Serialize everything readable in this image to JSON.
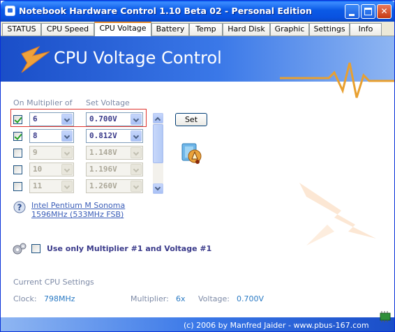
{
  "window": {
    "title": "Notebook Hardware Control 1.10 Beta 02  -  Personal Edition",
    "controls": {
      "minimize": "",
      "maximize": "",
      "close": "✕"
    }
  },
  "tabs": [
    {
      "label": "STATUS"
    },
    {
      "label": "CPU Speed"
    },
    {
      "label": "CPU Voltage",
      "active": true
    },
    {
      "label": "Battery"
    },
    {
      "label": "Temp"
    },
    {
      "label": "Hard Disk"
    },
    {
      "label": "Graphic"
    },
    {
      "label": "Settings"
    },
    {
      "label": "Info"
    }
  ],
  "banner": {
    "title": "CPU Voltage Control"
  },
  "table": {
    "col_multiplier": "On Multiplier of",
    "col_voltage": "Set Voltage",
    "rows": [
      {
        "checked": true,
        "multiplier": "6",
        "voltage": "0.700V",
        "enabled": true
      },
      {
        "checked": true,
        "multiplier": "8",
        "voltage": "0.812V",
        "enabled": true
      },
      {
        "checked": false,
        "multiplier": "9",
        "voltage": "1.148V",
        "enabled": false
      },
      {
        "checked": false,
        "multiplier": "10",
        "voltage": "1.196V",
        "enabled": false
      },
      {
        "checked": false,
        "multiplier": "11",
        "voltage": "1.260V",
        "enabled": false
      }
    ]
  },
  "set_button": "Set",
  "cpu_info": {
    "line1": "Intel Pentium M Sonoma",
    "line2": "1596MHz (533MHz FSB)"
  },
  "option": {
    "label": "Use only Multiplier #1 and Voltage #1",
    "checked": false
  },
  "current": {
    "heading": "Current CPU Settings",
    "clock_label": "Clock:",
    "clock_value": "798MHz",
    "multiplier_label": "Multiplier:",
    "multiplier_value": "6x",
    "voltage_label": "Voltage:",
    "voltage_value": "0.700V"
  },
  "footer": {
    "copyright": "(c) 2006 by Manfred Jaider  -  www.pbus-167.com"
  },
  "colors": {
    "accent": "#e68b2c",
    "title_bar": "#0a5ae6",
    "checkmark": "#21a121",
    "value_blue": "#2a7ac4"
  }
}
